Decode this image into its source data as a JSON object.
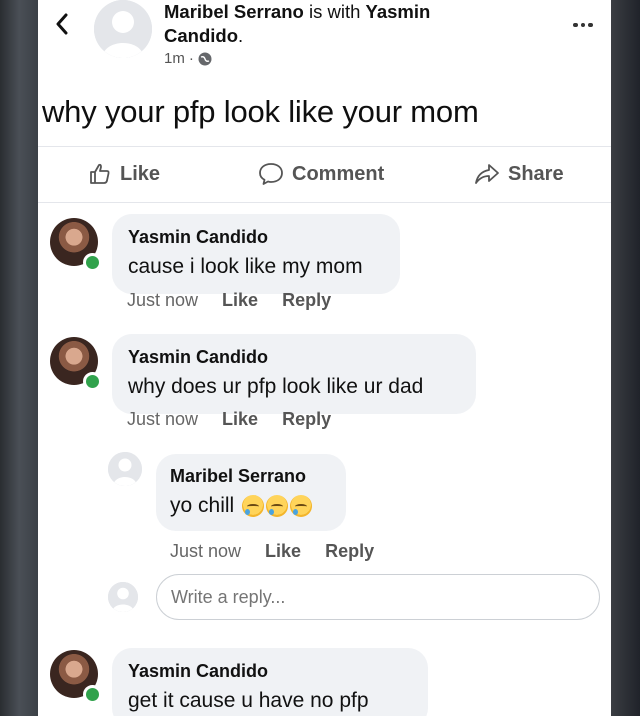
{
  "header": {
    "author": "Maribel Serrano",
    "with_text": " is with ",
    "tagged": "Yasmin Candido",
    "period": ".",
    "time": "1m",
    "dot": "·"
  },
  "post": {
    "text": "why your pfp look like your mom"
  },
  "actions": {
    "like": "Like",
    "comment": "Comment",
    "share": "Share"
  },
  "comments": [
    {
      "name": "Yasmin Candido",
      "text": "cause i look like my mom",
      "time": "Just now",
      "like": "Like",
      "reply": "Reply"
    },
    {
      "name": "Yasmin Candido",
      "text": "why does ur pfp look like ur dad",
      "time": "Just now",
      "like": "Like",
      "reply": "Reply"
    },
    {
      "name": "Maribel Serrano",
      "text": "yo chill",
      "time": "Just now",
      "like": "Like",
      "reply": "Reply"
    },
    {
      "name": "Yasmin Candido",
      "text": "get it cause u have no pfp"
    }
  ],
  "reply_box": {
    "placeholder": "Write a reply..."
  },
  "colors": {
    "online": "#31a24c",
    "bubble": "#f0f2f5"
  }
}
